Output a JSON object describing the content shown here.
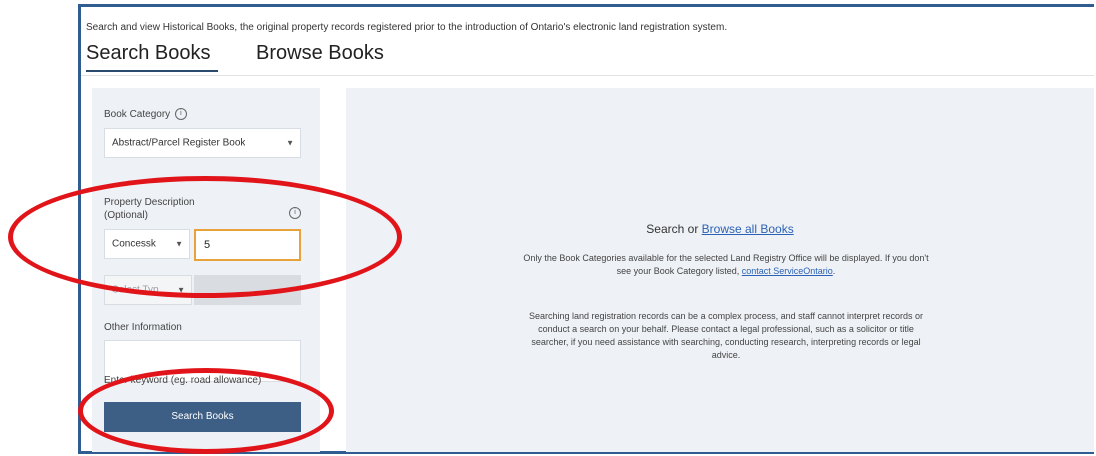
{
  "intro_text": "Search and view Historical Books, the original property records registered prior to the introduction of Ontario's electronic land registration system.",
  "tabs": [
    {
      "label": "Search Books",
      "active": true
    },
    {
      "label": "Browse Books",
      "active": false
    }
  ],
  "sidebar": {
    "book_category_label": "Book Category",
    "book_category_value": "Abstract/Parcel Register Book",
    "property_description_label_line1": "Property Description",
    "property_description_label_line2": "(Optional)",
    "concession_select_value": "Concessk",
    "concession_input_value": "5",
    "type_select_value": "Select Typ",
    "other_information_label": "Other Information",
    "keyword_placeholder": "Enter keyword (eg. road allowance)",
    "search_button_label": "Search Books"
  },
  "main": {
    "heading_prefix": "Search or ",
    "heading_link": "Browse all Books",
    "paragraph1_line1": "Only the Book Categories available for the selected Land Registry Office will be displayed. If you don't",
    "paragraph1_line2_prefix": "see your Book Category listed, ",
    "paragraph1_link": "contact ServiceOntario",
    "paragraph1_line2_suffix": ".",
    "paragraph2_line1": "Searching land registration records can be a complex process, and staff cannot interpret records or",
    "paragraph2_line2": "conduct a search on your behalf. Please contact a legal professional, such as a solicitor or title",
    "paragraph2_line3": "searcher, if you need assistance with searching, conducting research, interpreting records or legal",
    "paragraph2_line4": "advice."
  },
  "colors": {
    "frame_border": "#2f5d91",
    "button": "#3d5f86",
    "panel_bg": "#eef1f5",
    "annotation_ring": "#e1141a",
    "active_input_border": "#e8a23c",
    "link": "#2c62b5"
  },
  "icons": {
    "info": "info-icon",
    "dropdown": "chevron-down-icon"
  }
}
